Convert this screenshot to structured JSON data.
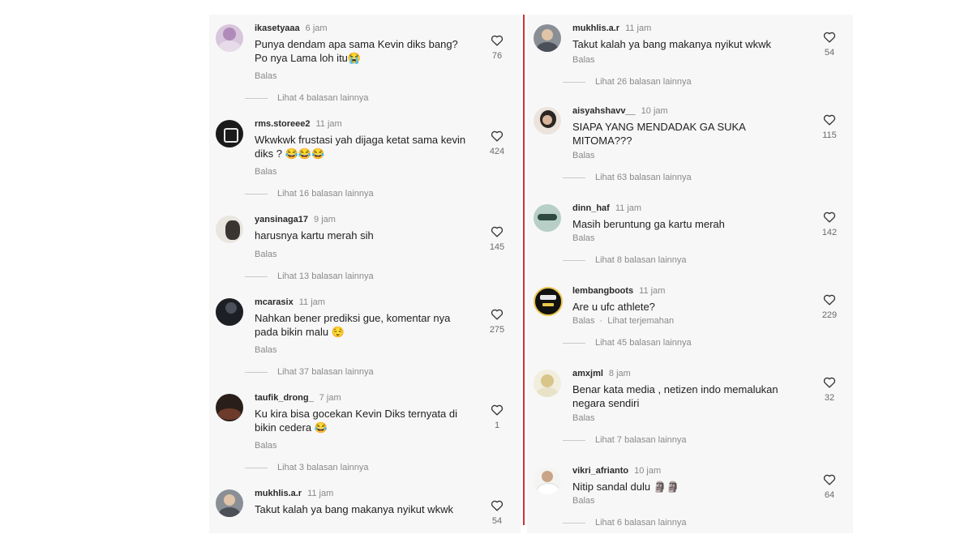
{
  "left_column": [
    {
      "username": "ikasetyaaa",
      "time": "6 jam",
      "text": "Punya dendam apa sama Kevin diks bang? Po nya Lama loh itu😭",
      "reply_label": "Balas",
      "more_replies": "Lihat 4 balasan lainnya",
      "likes": "76"
    },
    {
      "username": "rms.storeee2",
      "time": "11 jam",
      "text": "Wkwkwk frustasi yah dijaga ketat sama kevin diks ? 😂😂😂",
      "reply_label": "Balas",
      "more_replies": "Lihat 16 balasan lainnya",
      "likes": "424"
    },
    {
      "username": "yansinaga17",
      "time": "9 jam",
      "text": "harusnya kartu merah sih",
      "reply_label": "Balas",
      "more_replies": "Lihat 13 balasan lainnya",
      "likes": "145"
    },
    {
      "username": "mcarasix",
      "time": "11 jam",
      "text": "Nahkan bener prediksi gue, komentar nya pada bikin malu 😌",
      "reply_label": "Balas",
      "more_replies": "Lihat 37 balasan lainnya",
      "likes": "275"
    },
    {
      "username": "taufik_drong_",
      "time": "7 jam",
      "text": "Ku kira bisa gocekan  Kevin Diks ternyata di bikin cedera 😂",
      "reply_label": "Balas",
      "more_replies": "Lihat 3 balasan lainnya",
      "likes": "1"
    },
    {
      "username": "mukhlis.a.r",
      "time": "11 jam",
      "text": "Takut kalah ya bang makanya nyikut wkwk",
      "reply_label": "",
      "more_replies": "",
      "likes": "54"
    }
  ],
  "right_column": [
    {
      "username": "mukhlis.a.r",
      "time": "11 jam",
      "text": "Takut kalah ya bang makanya nyikut wkwk",
      "reply_label": "Balas",
      "more_replies": "Lihat 26 balasan lainnya",
      "likes": "54"
    },
    {
      "username": "aisyahshavv__",
      "time": "10 jam",
      "text": "SIAPA YANG MENDADAK GA SUKA MITOMA???",
      "reply_label": "Balas",
      "more_replies": "Lihat 63 balasan lainnya",
      "likes": "115"
    },
    {
      "username": "dinn_haf",
      "time": "11 jam",
      "text": "Masih beruntung ga kartu merah",
      "reply_label": "Balas",
      "more_replies": "Lihat 8 balasan lainnya",
      "likes": "142"
    },
    {
      "username": "lembangboots",
      "time": "11 jam",
      "text": "Are u ufc athlete?",
      "reply_label": "Balas",
      "translate_label": "Lihat terjemahan",
      "more_replies": "Lihat 45 balasan lainnya",
      "likes": "229"
    },
    {
      "username": "amxjml",
      "time": "8 jam",
      "text": "Benar kata media , netizen indo memalukan negara sendiri",
      "reply_label": "Balas",
      "more_replies": "Lihat 7 balasan lainnya",
      "likes": "32"
    },
    {
      "username": "vikri_afrianto",
      "time": "10 jam",
      "text": "Nitip sandal dulu 🗿🗿",
      "reply_label": "Balas",
      "more_replies": "Lihat 6 balasan lainnya",
      "likes": "64"
    }
  ],
  "icons": {
    "like": "heart-outline-icon"
  },
  "colors": {
    "divider": "#cf3434",
    "panel_bg": "#f7f7f8",
    "muted_text": "#8a8a8a"
  }
}
